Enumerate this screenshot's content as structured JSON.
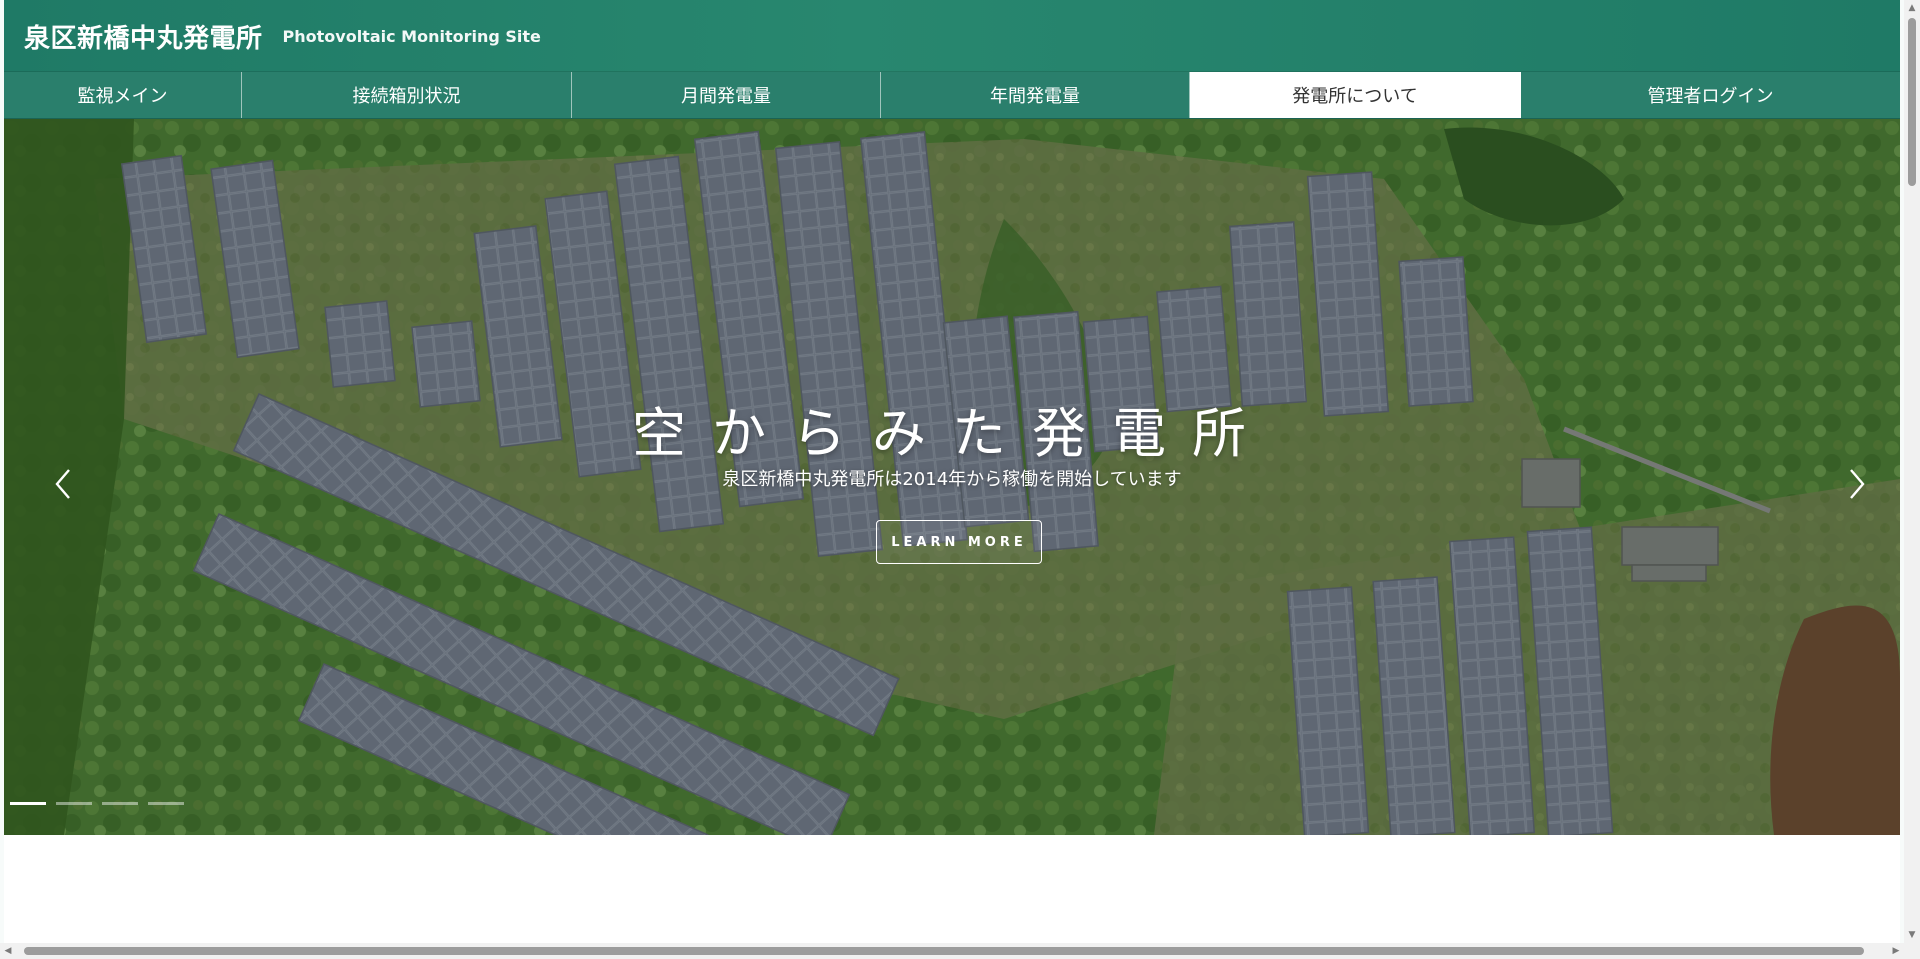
{
  "header": {
    "title": "泉区新橋中丸発電所",
    "subtitle": "Photovoltaic Monitoring Site"
  },
  "nav": {
    "items": [
      {
        "label": "監視メイン"
      },
      {
        "label": "接続箱別状況"
      },
      {
        "label": "月間発電量"
      },
      {
        "label": "年間発電量"
      },
      {
        "label": "発電所について",
        "active": true
      },
      {
        "label": "管理者ログイン"
      }
    ]
  },
  "hero": {
    "heading": "空からみた発電所",
    "subheading": "泉区新橋中丸発電所は2014年から稼働を開始しています",
    "button_label": "LEARN MORE",
    "slide_count": 4,
    "active_slide": 1,
    "prev_icon": "chevron-left-icon",
    "next_icon": "chevron-right-icon"
  },
  "colors": {
    "header_bg": "#1f7a66",
    "nav_bg": "#2a7f6c",
    "active_tab_bg": "#ffffff",
    "vegetation": "#3d6a2c",
    "panel": "#76808f"
  }
}
